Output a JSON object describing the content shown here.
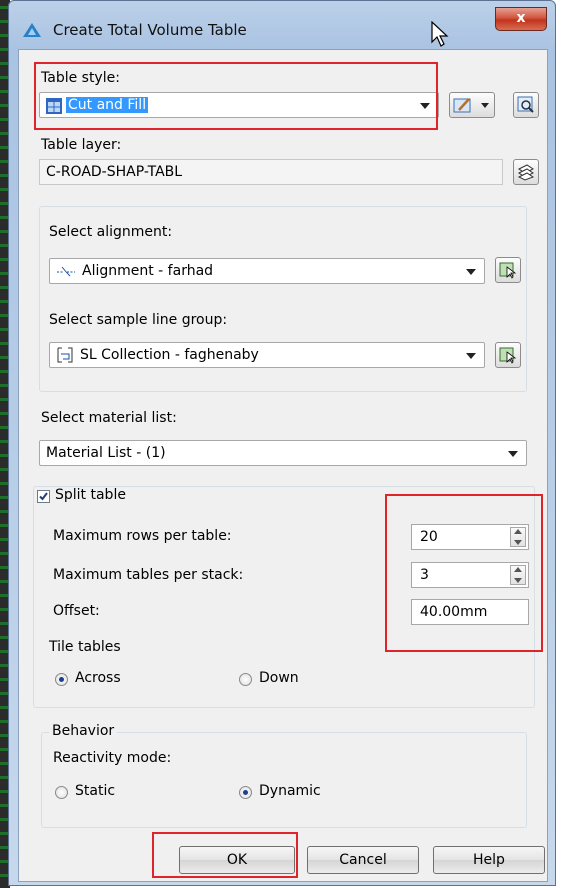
{
  "window": {
    "title": "Create Total Volume Table",
    "close_label": "x"
  },
  "table_style": {
    "label": "Table style:",
    "value": "Cut and Fill"
  },
  "table_layer": {
    "label": "Table layer:",
    "value": "C-ROAD-SHAP-TABL"
  },
  "alignment": {
    "label": "Select alignment:",
    "value": "Alignment - farhad"
  },
  "sample_line_group": {
    "label": "Select sample line group:",
    "value": "SL Collection - faghenaby"
  },
  "material_list": {
    "label": "Select material list:",
    "value": "Material List - (1)"
  },
  "split_table": {
    "label": "Split table",
    "checked": true,
    "max_rows_label": "Maximum rows per table:",
    "max_rows_value": "20",
    "max_tables_label": "Maximum tables per stack:",
    "max_tables_value": "3",
    "offset_label": "Offset:",
    "offset_value": "40.00mm"
  },
  "tile_tables": {
    "label": "Tile tables",
    "across": "Across",
    "down": "Down",
    "selected": "Across"
  },
  "behavior": {
    "label": "Behavior",
    "reactivity_label": "Reactivity mode:",
    "static": "Static",
    "dynamic": "Dynamic",
    "selected": "Dynamic"
  },
  "buttons": {
    "ok": "OK",
    "cancel": "Cancel",
    "help": "Help"
  },
  "colors": {
    "highlight": "#e0242b",
    "selection": "#3399ff",
    "accent": "#1c3f8f"
  }
}
